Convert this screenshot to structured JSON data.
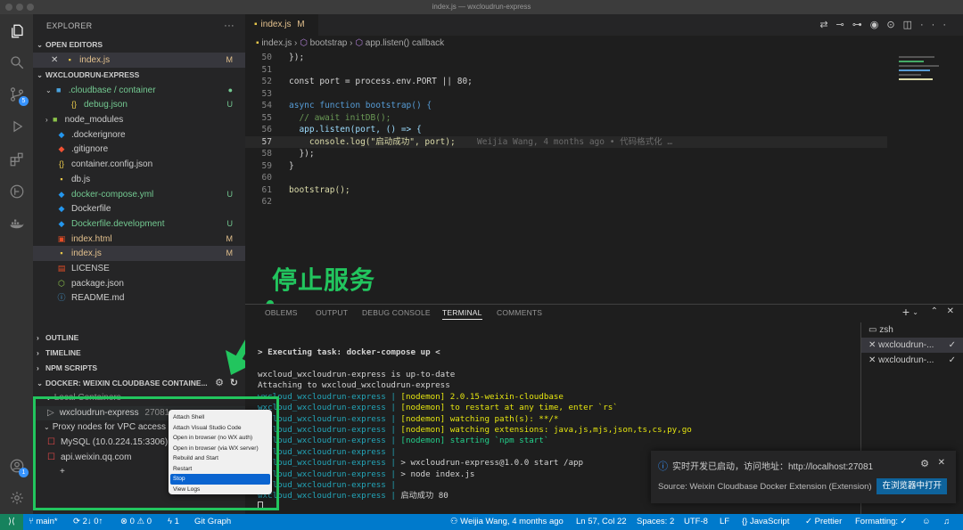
{
  "window": {
    "title": "index.js — wxcloudrun-express"
  },
  "activity": {
    "scm_badge": "5",
    "account_badge": "1"
  },
  "sidebar": {
    "title": "EXPLORER",
    "open_editors": {
      "header": "OPEN EDITORS",
      "items": [
        {
          "name": "index.js",
          "status": "M"
        }
      ]
    },
    "project": {
      "header": "WXCLOUDRUN-EXPRESS",
      "items": [
        {
          "name": ".cloudbase / container",
          "status": "●",
          "icon": "folder"
        },
        {
          "name": "debug.json",
          "status": "U",
          "icon": "{..}"
        },
        {
          "name": "node_modules",
          "status": "",
          "icon": "folder"
        },
        {
          "name": ".dockerignore",
          "status": "",
          "icon": "docker"
        },
        {
          "name": ".gitignore",
          "status": "",
          "icon": "git"
        },
        {
          "name": "container.config.json",
          "status": "",
          "icon": "{..}"
        },
        {
          "name": "db.js",
          "status": "",
          "icon": "js"
        },
        {
          "name": "docker-compose.yml",
          "status": "U",
          "icon": "docker"
        },
        {
          "name": "Dockerfile",
          "status": "",
          "icon": "docker"
        },
        {
          "name": "Dockerfile.development",
          "status": "U",
          "icon": "docker"
        },
        {
          "name": "index.html",
          "status": "M",
          "icon": "html"
        },
        {
          "name": "index.js",
          "status": "M",
          "icon": "js"
        },
        {
          "name": "LICENSE",
          "status": "",
          "icon": "license"
        },
        {
          "name": "package.json",
          "status": "",
          "icon": "node"
        },
        {
          "name": "README.md",
          "status": "",
          "icon": "info"
        }
      ]
    },
    "sections": {
      "outline": "OUTLINE",
      "timeline": "TIMELINE",
      "npm": "NPM SCRIPTS",
      "docker": "DOCKER: WEIXIN CLOUDBASE CONTAINE..."
    },
    "docker": {
      "local_containers": "Local Containers",
      "container": "wxcloudrun-express",
      "container_id": "27081",
      "proxy_nodes": "Proxy nodes for VPC access",
      "mysql": "MySQL (10.0.224.15:3306)",
      "api": "api.weixin.qq.com",
      "add": "+"
    }
  },
  "editor": {
    "tab": {
      "label": "index.js",
      "status": "M"
    },
    "breadcrumb": {
      "file": "index.js",
      "fn1": "bootstrap",
      "fn2": "app.listen() callback"
    },
    "lines": [
      {
        "n": "50",
        "t": "});"
      },
      {
        "n": "51",
        "t": ""
      },
      {
        "n": "52",
        "t": "const port = process.env.PORT || 80;"
      },
      {
        "n": "53",
        "t": ""
      },
      {
        "n": "54",
        "t": "async function bootstrap() {"
      },
      {
        "n": "55",
        "t": "  // await initDB();"
      },
      {
        "n": "56",
        "t": "  app.listen(port, () => {"
      },
      {
        "n": "57",
        "t": "    console.log(\"启动成功\", port);"
      },
      {
        "n": "58",
        "t": "  });"
      },
      {
        "n": "59",
        "t": "}"
      },
      {
        "n": "60",
        "t": ""
      },
      {
        "n": "61",
        "t": "bootstrap();"
      },
      {
        "n": "62",
        "t": ""
      }
    ],
    "blame": "Weijia Wang, 4 months ago • 代码格式化 …"
  },
  "annotation": {
    "text": "停止服务"
  },
  "panel": {
    "tabs": [
      "OBLEMS",
      "OUTPUT",
      "DEBUG CONSOLE",
      "TERMINAL",
      "COMMENTS"
    ],
    "active_tab": "TERMINAL",
    "terminal": [
      {
        "p": "",
        "m": "> Executing task: docker-compose up <"
      },
      {
        "p": "",
        "m": ""
      },
      {
        "p": "",
        "m": "wxcloud_wxcloudrun-express is up-to-date"
      },
      {
        "p": "",
        "m": "Attaching to wxcloud_wxcloudrun-express"
      },
      {
        "p": "wxcloud_wxcloudrun-express | ",
        "m": "[nodemon] 2.0.15-weixin-cloudbase"
      },
      {
        "p": "wxcloud_wxcloudrun-express | ",
        "m": "[nodemon] to restart at any time, enter `rs`"
      },
      {
        "p": "wxcloud_wxcloudrun-express | ",
        "m": "[nodemon] watching path(s): **/*"
      },
      {
        "p": "wxcloud_wxcloudrun-express | ",
        "m": "[nodemon] watching extensions: java,js,mjs,json,ts,cs,py,go"
      },
      {
        "p": "wxcloud_wxcloudrun-express | ",
        "m": "[nodemon] starting `npm start`"
      },
      {
        "p": "wxcloud_wxcloudrun-express | ",
        "m": ""
      },
      {
        "p": "wxcloud_wxcloudrun-express | ",
        "m": "> wxcloudrun-express@1.0.0 start /app"
      },
      {
        "p": "wxcloud_wxcloudrun-express | ",
        "m": "> node index.js"
      },
      {
        "p": "wxcloud_wxcloudrun-express | ",
        "m": ""
      },
      {
        "p": "wxcloud_wxcloudrun-express | ",
        "m": "启动成功 80"
      }
    ],
    "terminals": [
      {
        "name": "zsh"
      },
      {
        "name": "wxcloudrun-..."
      },
      {
        "name": "wxcloudrun-..."
      }
    ],
    "plus": "+"
  },
  "context_menu": {
    "items": [
      "Attach Shell",
      "Attach Visual Studio Code",
      "Open in browser (no WX auth)",
      "Open in browser (via WX server)",
      "Rebuild and Start",
      "Restart",
      "Stop",
      "View Logs"
    ],
    "active": "Stop"
  },
  "notification": {
    "message": "实时开发已启动，访问地址：http://localhost:27081",
    "source": "Source: Weixin Cloudbase Docker Extension (Extension)",
    "button": "在浏览器中打开"
  },
  "statusbar": {
    "branch": "main*",
    "sync": "2↓ 0↑",
    "errors": "0",
    "warnings": "0",
    "ports": "1",
    "git_graph": "Git Graph",
    "blame": "Weijia Wang, 4 months ago",
    "position": "Ln 57, Col 22",
    "spaces": "Spaces: 2",
    "encoding": "UTF-8",
    "eol": "LF",
    "language": "JavaScript",
    "prettier": "Prettier",
    "formatting": "Formatting: ✓"
  },
  "colors": {
    "accent": "#007acc",
    "annotation": "#22c55e",
    "modified": "#e2c08d",
    "untracked": "#73c991"
  }
}
